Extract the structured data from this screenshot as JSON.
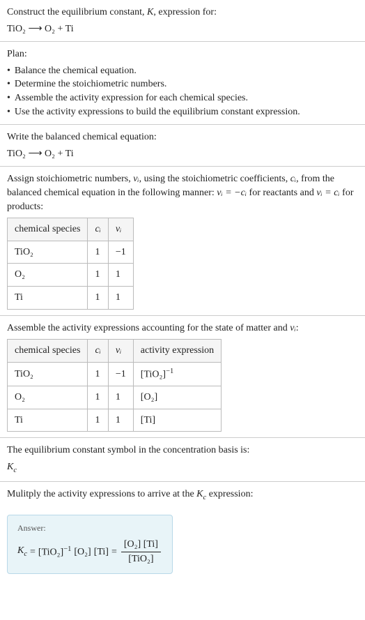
{
  "header": {
    "construct_line": "Construct the equilibrium constant, K, expression for:",
    "equation": "TiO₂ ⟶ O₂ + Ti"
  },
  "plan": {
    "title": "Plan:",
    "items": [
      "Balance the chemical equation.",
      "Determine the stoichiometric numbers.",
      "Assemble the activity expression for each chemical species.",
      "Use the activity expressions to build the equilibrium constant expression."
    ]
  },
  "balanced": {
    "intro": "Write the balanced chemical equation:",
    "equation": "TiO₂ ⟶ O₂ + Ti"
  },
  "stoich": {
    "intro_a": "Assign stoichiometric numbers, ",
    "intro_b": ", using the stoichiometric coefficients, ",
    "intro_c": ", from the balanced chemical equation in the following manner: ",
    "intro_d": " for reactants and ",
    "intro_e": " for products:",
    "nu_i": "νᵢ",
    "c_i": "cᵢ",
    "rel1": "νᵢ = −cᵢ",
    "rel2": "νᵢ = cᵢ",
    "table": {
      "headers": [
        "chemical species",
        "cᵢ",
        "νᵢ"
      ],
      "rows": [
        [
          "TiO₂",
          "1",
          "−1"
        ],
        [
          "O₂",
          "1",
          "1"
        ],
        [
          "Ti",
          "1",
          "1"
        ]
      ]
    }
  },
  "activity": {
    "intro_a": "Assemble the activity expressions accounting for the state of matter and ",
    "intro_b": ":",
    "nu_i": "νᵢ",
    "table": {
      "headers": [
        "chemical species",
        "cᵢ",
        "νᵢ",
        "activity expression"
      ],
      "rows": [
        {
          "species": "TiO₂",
          "ci": "1",
          "vi": "−1",
          "expr_base": "[TiO₂]",
          "expr_sup": "−1"
        },
        {
          "species": "O₂",
          "ci": "1",
          "vi": "1",
          "expr_base": "[O₂]",
          "expr_sup": ""
        },
        {
          "species": "Ti",
          "ci": "1",
          "vi": "1",
          "expr_base": "[Ti]",
          "expr_sup": ""
        }
      ]
    }
  },
  "symbol": {
    "intro": "The equilibrium constant symbol in the concentration basis is:",
    "Kc": "K",
    "Kc_sub": "c"
  },
  "multiply": {
    "intro_a": "Mulitply the activity expressions to arrive at the ",
    "intro_b": " expression:",
    "Kc": "K",
    "Kc_sub": "c"
  },
  "answer": {
    "label": "Answer:",
    "lhs": "Kc = ",
    "term1_base": "[TiO₂]",
    "term1_sup": "−1",
    "term2": "[O₂]",
    "term3": "[Ti]",
    "eq": " = ",
    "frac_num": "[O₂] [Ti]",
    "frac_den": "[TiO₂]"
  }
}
